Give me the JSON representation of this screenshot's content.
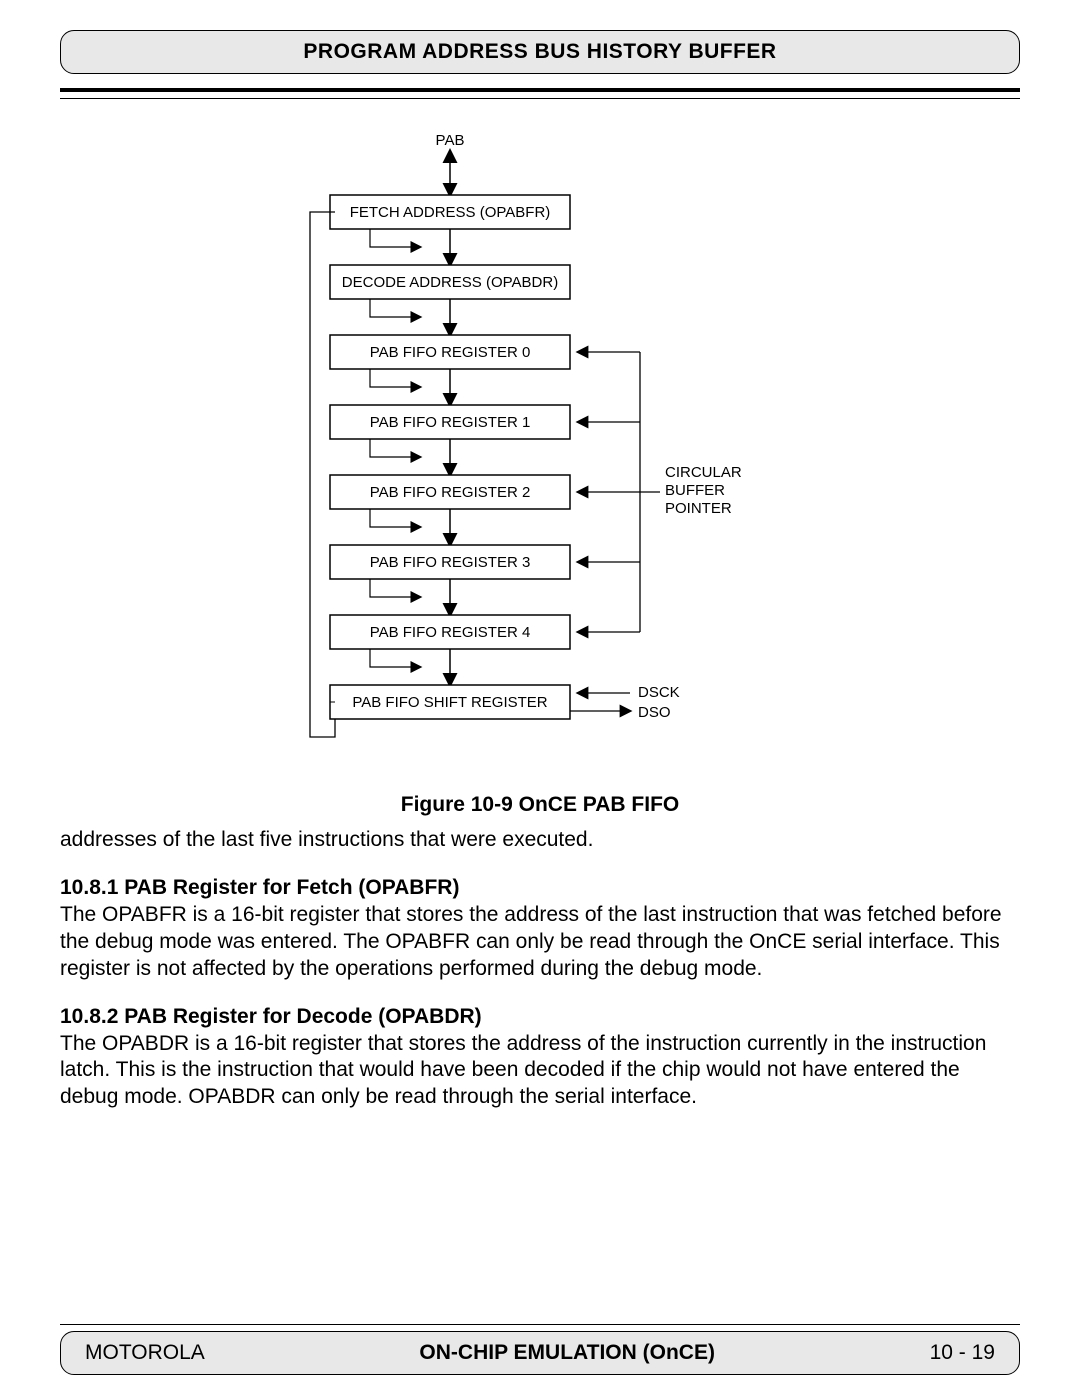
{
  "header": {
    "title": "PROGRAM ADDRESS BUS HISTORY BUFFER"
  },
  "diagram": {
    "pab_label": "PAB",
    "boxes": {
      "fetch": "FETCH ADDRESS (OPABFR)",
      "decode": "DECODE ADDRESS (OPABDR)",
      "fifo0": "PAB FIFO REGISTER 0",
      "fifo1": "PAB FIFO REGISTER 1",
      "fifo2": "PAB FIFO REGISTER 2",
      "fifo3": "PAB FIFO REGISTER 3",
      "fifo4": "PAB FIFO REGISTER 4",
      "shift": "PAB FIFO SHIFT REGISTER"
    },
    "pointer": {
      "l1": "CIRCULAR",
      "l2": "BUFFER",
      "l3": "POINTER"
    },
    "dsck": "DSCK",
    "dso": "DSO"
  },
  "figure_caption": "Figure  10-9 OnCE PAB FIFO",
  "intro_text": "addresses of the last five instructions that were executed.",
  "section1": {
    "heading": "10.8.1   PAB Register for Fetch (OPABFR)",
    "body": "The OPABFR is a 16-bit register that stores the address of the last instruction that was fetched before the debug mode was entered. The OPABFR can only be read through the OnCE serial interface. This register is not affected by the operations performed during the debug mode."
  },
  "section2": {
    "heading": "10.8.2   PAB Register for Decode (OPABDR)",
    "body": "The OPABDR is a 16-bit register that stores the address of the instruction currently in the instruction latch. This is the instruction that would have been decoded if the chip would not have entered the debug mode. OPABDR can only be read through the serial interface."
  },
  "footer": {
    "left": "MOTOROLA",
    "center": "ON-CHIP EMULATION (OnCE)",
    "right": "10 - 19"
  }
}
